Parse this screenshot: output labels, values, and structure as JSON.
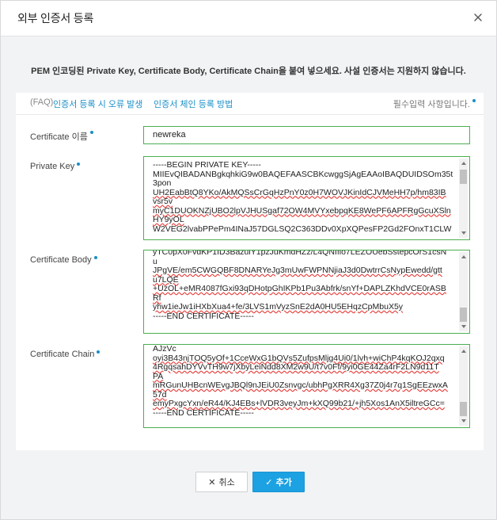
{
  "dialog": {
    "title": "외부 인증서 등록",
    "notice": "PEM 인코딩된 Private Key, Certificate Body, Certificate Chain을 붙여 넣으세요. 사설 인증서는 지원하지 않습니다."
  },
  "faq": {
    "prefix": "(FAQ)",
    "link1": "인증서 등록 시 오류 발생",
    "link2": "인증서 체인 등록 방법",
    "required_note": "필수입력 사항입니다."
  },
  "fields": {
    "name": {
      "label": "Certificate 이름",
      "value": "newreka"
    },
    "private_key": {
      "label": "Private Key",
      "lines": [
        "-----BEGIN PRIVATE KEY-----",
        "MIIEvQIBADANBgkqhkiG9w0BAQEFAASCBKcwggSjAgEAAoIBAQDUIDSOm35t",
        "3pon",
        "UH2EabBtQ8YKo/AkMQSsCrGqHzPnY0z0H7WOVJKinIdCJVMeHH7p/hm83IB",
        "vsr5v",
        "myC1DUOKNZjUBO2lpVJHUSgaf72OW4MVYxebpqKE8WePF6APFRgGcuXSln",
        "HY9yOL",
        "W2VEG2lvabPPePm4INaJ57DGLSQ2C363DDv0XpXQPesFP2Gd2FOnxT1CLW"
      ]
    },
    "cert_body": {
      "label": "Certificate Body",
      "lines": [
        "yTC0pX0FvdKP1ID3BazulY1pzJuKmdHZz/L4QNIfio7LEZOUebSstepcOrS1csN",
        "u",
        "JPgVE/em5CWGQBF8DNARYeJg3mUwFWPNNjiaJ3d0DwtrrCsNypEwedd/gtt",
        "u7LQE",
        "+UzOL+eMR4087fGxi93qDHotpGhIKPb1Pu3Abfrk/snYf+DAPLZKhdVCE0rASB",
        "Rf",
        "yhw1ieJw1iHXbXua4+fe/3LVS1mVyzSnE2dA0HU5EHqzCpMbuX5y",
        "-----END CERTIFICATE-----"
      ]
    },
    "cert_chain": {
      "label": "Certificate Chain",
      "lines": [
        "AJzVc",
        "oyi3B43njTOQ5yOf+1CceWxG1bQVs5ZufpsMljg4Ui0/1lvh+wiChP4kqKOJ2qxq",
        "4RgqsahDYVvTH9w7jXbyLeiNdd8XM2w9U/t7v0Ff/9yi0GE44Za4rF2LN9d11T",
        "PA",
        "mRGunUHBcnWEvgJBQl9nJEiU0Zsnvgc/ubhPgXRR4Xg37Z0j4r7q1SgEEzwxA",
        "57d",
        "emyPxgcYxn/eR44/KJ4EBs+lVDR3veyJm+kXQ99b21/+jh5Xos1AnX5iltreGCc=",
        "-----END CERTIFICATE-----"
      ]
    }
  },
  "buttons": {
    "cancel": "취소",
    "add": "추가"
  },
  "colors": {
    "accent": "#1ca1e2",
    "valid_border": "#4caf50",
    "link": "#1a8ec7"
  }
}
